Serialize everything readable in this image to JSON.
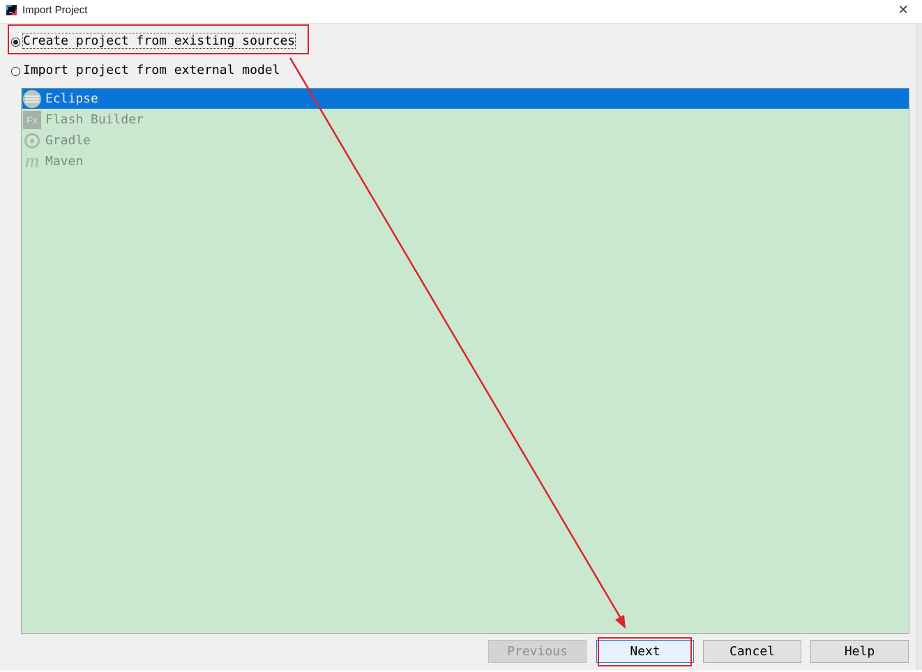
{
  "window": {
    "title": "Import Project",
    "close_icon": "close-icon"
  },
  "options": [
    {
      "label": "Create project from existing sources",
      "selected": true
    },
    {
      "label": "Import project from external model",
      "selected": false
    }
  ],
  "models": [
    {
      "label": "Eclipse",
      "icon": "eclipse-icon",
      "selected": true
    },
    {
      "label": "Flash Builder",
      "icon": "flash-builder-icon",
      "icon_text": "Fx",
      "selected": false
    },
    {
      "label": "Gradle",
      "icon": "gradle-icon",
      "selected": false
    },
    {
      "label": "Maven",
      "icon": "maven-icon",
      "icon_text": "m",
      "selected": false
    }
  ],
  "buttons": {
    "previous": "Previous",
    "next": "Next",
    "cancel": "Cancel",
    "help": "Help"
  },
  "colors": {
    "selection": "#0a74d8",
    "list_background": "#cae8cf",
    "annotation": "#e0212b"
  }
}
